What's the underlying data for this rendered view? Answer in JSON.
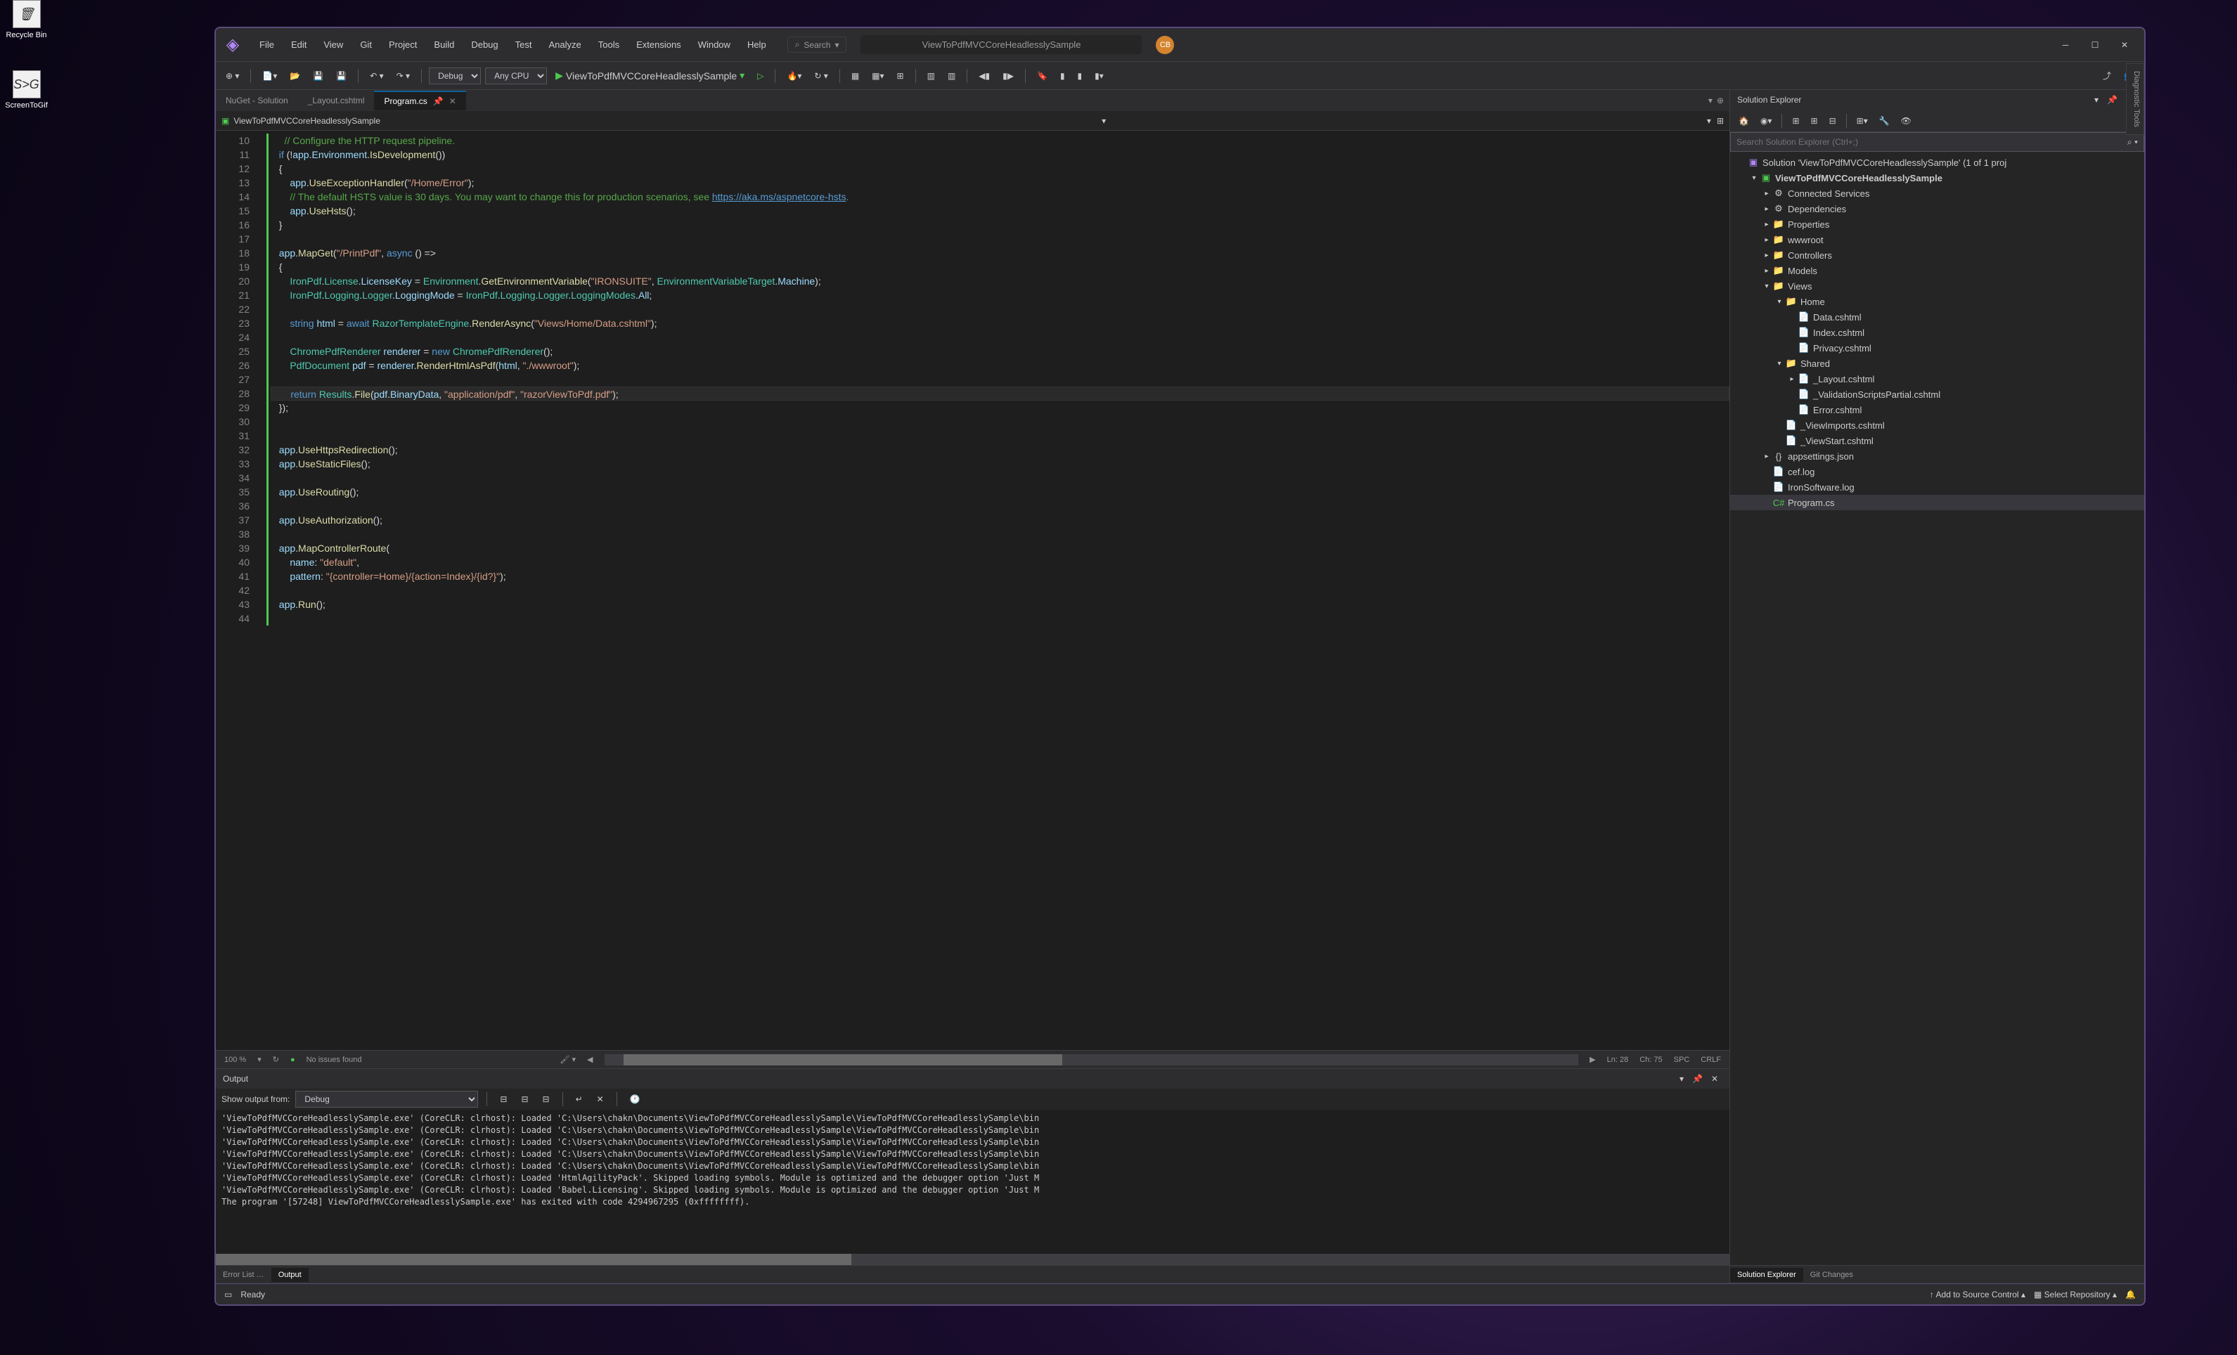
{
  "desktop": {
    "recycle": "Recycle Bin",
    "s2g": "ScreenToGif",
    "s2g_badge": "S>G"
  },
  "menus": [
    "File",
    "Edit",
    "View",
    "Git",
    "Project",
    "Build",
    "Debug",
    "Test",
    "Analyze",
    "Tools",
    "Extensions",
    "Window",
    "Help"
  ],
  "search": "Search",
  "titlebar": {
    "title": "ViewToPdfMVCCoreHeadlesslySample",
    "avatar": "CB"
  },
  "toolbar": {
    "config": "Debug",
    "platform": "Any CPU",
    "start": "ViewToPdfMVCCoreHeadlesslySample"
  },
  "tabs": [
    {
      "label": "NuGet - Solution",
      "active": false
    },
    {
      "label": "_Layout.cshtml",
      "active": false
    },
    {
      "label": "Program.cs",
      "active": true
    }
  ],
  "navbar": "ViewToPdfMVCCoreHeadlesslySample",
  "code": {
    "start": 10,
    "lines": [
      [
        [
          "comment",
          "    // Configure the HTTP request pipeline."
        ]
      ],
      [
        [
          "plain",
          "  "
        ],
        [
          "keyword",
          "if"
        ],
        [
          "plain",
          " (!"
        ],
        [
          "var",
          "app"
        ],
        [
          "plain",
          "."
        ],
        [
          "var",
          "Environment"
        ],
        [
          "plain",
          "."
        ],
        [
          "method",
          "IsDevelopment"
        ],
        [
          "plain",
          "())"
        ]
      ],
      [
        [
          "plain",
          "  {"
        ]
      ],
      [
        [
          "plain",
          "      "
        ],
        [
          "var",
          "app"
        ],
        [
          "plain",
          "."
        ],
        [
          "method",
          "UseExceptionHandler"
        ],
        [
          "plain",
          "("
        ],
        [
          "string",
          "\"/Home/Error\""
        ],
        [
          "plain",
          ");"
        ]
      ],
      [
        [
          "comment",
          "      // The default HSTS value is 30 days. You may want to change this for production scenarios, see "
        ],
        [
          "link",
          "https://aka.ms/aspnetcore-hsts"
        ],
        [
          "comment",
          "."
        ]
      ],
      [
        [
          "plain",
          "      "
        ],
        [
          "var",
          "app"
        ],
        [
          "plain",
          "."
        ],
        [
          "method",
          "UseHsts"
        ],
        [
          "plain",
          "();"
        ]
      ],
      [
        [
          "plain",
          "  }"
        ]
      ],
      [],
      [
        [
          "plain",
          "  "
        ],
        [
          "var",
          "app"
        ],
        [
          "plain",
          "."
        ],
        [
          "method",
          "MapGet"
        ],
        [
          "plain",
          "("
        ],
        [
          "string",
          "\"/PrintPdf\""
        ],
        [
          "plain",
          ", "
        ],
        [
          "keyword",
          "async"
        ],
        [
          "plain",
          " () =>"
        ]
      ],
      [
        [
          "plain",
          "  {"
        ]
      ],
      [
        [
          "plain",
          "      "
        ],
        [
          "type",
          "IronPdf"
        ],
        [
          "plain",
          "."
        ],
        [
          "type",
          "License"
        ],
        [
          "plain",
          "."
        ],
        [
          "var",
          "LicenseKey"
        ],
        [
          "plain",
          " = "
        ],
        [
          "type",
          "Environment"
        ],
        [
          "plain",
          "."
        ],
        [
          "method",
          "GetEnvironmentVariable"
        ],
        [
          "plain",
          "("
        ],
        [
          "string",
          "\"IRONSUITE\""
        ],
        [
          "plain",
          ", "
        ],
        [
          "type",
          "EnvironmentVariableTarget"
        ],
        [
          "plain",
          "."
        ],
        [
          "var",
          "Machine"
        ],
        [
          "plain",
          ");"
        ]
      ],
      [
        [
          "plain",
          "      "
        ],
        [
          "type",
          "IronPdf"
        ],
        [
          "plain",
          "."
        ],
        [
          "type",
          "Logging"
        ],
        [
          "plain",
          "."
        ],
        [
          "type",
          "Logger"
        ],
        [
          "plain",
          "."
        ],
        [
          "var",
          "LoggingMode"
        ],
        [
          "plain",
          " = "
        ],
        [
          "type",
          "IronPdf"
        ],
        [
          "plain",
          "."
        ],
        [
          "type",
          "Logging"
        ],
        [
          "plain",
          "."
        ],
        [
          "type",
          "Logger"
        ],
        [
          "plain",
          "."
        ],
        [
          "type",
          "LoggingModes"
        ],
        [
          "plain",
          "."
        ],
        [
          "var",
          "All"
        ],
        [
          "plain",
          ";"
        ]
      ],
      [],
      [
        [
          "plain",
          "      "
        ],
        [
          "keyword",
          "string"
        ],
        [
          "plain",
          " "
        ],
        [
          "var",
          "html"
        ],
        [
          "plain",
          " = "
        ],
        [
          "keyword",
          "await"
        ],
        [
          "plain",
          " "
        ],
        [
          "type",
          "RazorTemplateEngine"
        ],
        [
          "plain",
          "."
        ],
        [
          "method",
          "RenderAsync"
        ],
        [
          "plain",
          "("
        ],
        [
          "string",
          "\"Views/Home/Data.cshtml\""
        ],
        [
          "plain",
          ");"
        ]
      ],
      [],
      [
        [
          "plain",
          "      "
        ],
        [
          "type",
          "ChromePdfRenderer"
        ],
        [
          "plain",
          " "
        ],
        [
          "var",
          "renderer"
        ],
        [
          "plain",
          " = "
        ],
        [
          "keyword",
          "new"
        ],
        [
          "plain",
          " "
        ],
        [
          "type",
          "ChromePdfRenderer"
        ],
        [
          "plain",
          "();"
        ]
      ],
      [
        [
          "plain",
          "      "
        ],
        [
          "type",
          "PdfDocument"
        ],
        [
          "plain",
          " "
        ],
        [
          "var",
          "pdf"
        ],
        [
          "plain",
          " = "
        ],
        [
          "var",
          "renderer"
        ],
        [
          "plain",
          "."
        ],
        [
          "method",
          "RenderHtmlAsPdf"
        ],
        [
          "plain",
          "("
        ],
        [
          "var",
          "html"
        ],
        [
          "plain",
          ", "
        ],
        [
          "string",
          "\"./wwwroot\""
        ],
        [
          "plain",
          ");"
        ]
      ],
      [],
      [
        [
          "plain",
          "      "
        ],
        [
          "keyword",
          "return"
        ],
        [
          "plain",
          " "
        ],
        [
          "type",
          "Results"
        ],
        [
          "plain",
          "."
        ],
        [
          "method",
          "File"
        ],
        [
          "plain",
          "("
        ],
        [
          "var",
          "pdf"
        ],
        [
          "plain",
          "."
        ],
        [
          "var",
          "BinaryData"
        ],
        [
          "plain",
          ", "
        ],
        [
          "string",
          "\"application/pdf\""
        ],
        [
          "plain",
          ", "
        ],
        [
          "string",
          "\"razorViewToPdf.pdf\""
        ],
        [
          "plain",
          ");"
        ]
      ],
      [
        [
          "plain",
          "  });"
        ]
      ],
      [],
      [],
      [
        [
          "plain",
          "  "
        ],
        [
          "var",
          "app"
        ],
        [
          "plain",
          "."
        ],
        [
          "method",
          "UseHttpsRedirection"
        ],
        [
          "plain",
          "();"
        ]
      ],
      [
        [
          "plain",
          "  "
        ],
        [
          "var",
          "app"
        ],
        [
          "plain",
          "."
        ],
        [
          "method",
          "UseStaticFiles"
        ],
        [
          "plain",
          "();"
        ]
      ],
      [],
      [
        [
          "plain",
          "  "
        ],
        [
          "var",
          "app"
        ],
        [
          "plain",
          "."
        ],
        [
          "method",
          "UseRouting"
        ],
        [
          "plain",
          "();"
        ]
      ],
      [],
      [
        [
          "plain",
          "  "
        ],
        [
          "var",
          "app"
        ],
        [
          "plain",
          "."
        ],
        [
          "method",
          "UseAuthorization"
        ],
        [
          "plain",
          "();"
        ]
      ],
      [],
      [
        [
          "plain",
          "  "
        ],
        [
          "var",
          "app"
        ],
        [
          "plain",
          "."
        ],
        [
          "method",
          "MapControllerRoute"
        ],
        [
          "plain",
          "("
        ]
      ],
      [
        [
          "plain",
          "      "
        ],
        [
          "var",
          "name"
        ],
        [
          "plain",
          ": "
        ],
        [
          "string",
          "\"default\""
        ],
        [
          "plain",
          ","
        ]
      ],
      [
        [
          "plain",
          "      "
        ],
        [
          "var",
          "pattern"
        ],
        [
          "plain",
          ": "
        ],
        [
          "string",
          "\"{controller=Home}/{action=Index}/{id?}\""
        ],
        [
          "plain",
          ");"
        ]
      ],
      [],
      [
        [
          "plain",
          "  "
        ],
        [
          "var",
          "app"
        ],
        [
          "plain",
          "."
        ],
        [
          "method",
          "Run"
        ],
        [
          "plain",
          "();"
        ]
      ],
      []
    ],
    "current_line": 28
  },
  "editor_status": {
    "zoom": "100 %",
    "issues": "No issues found",
    "ln": "Ln: 28",
    "ch": "Ch: 75",
    "spc": "SPC",
    "crlf": "CRLF"
  },
  "output": {
    "title": "Output",
    "show_from": "Show output from:",
    "source": "Debug",
    "lines": [
      "'ViewToPdfMVCCoreHeadlesslySample.exe' (CoreCLR: clrhost): Loaded 'C:\\Users\\chakn\\Documents\\ViewToPdfMVCCoreHeadlesslySample\\ViewToPdfMVCCoreHeadlesslySample\\bin",
      "'ViewToPdfMVCCoreHeadlesslySample.exe' (CoreCLR: clrhost): Loaded 'C:\\Users\\chakn\\Documents\\ViewToPdfMVCCoreHeadlesslySample\\ViewToPdfMVCCoreHeadlesslySample\\bin",
      "'ViewToPdfMVCCoreHeadlesslySample.exe' (CoreCLR: clrhost): Loaded 'C:\\Users\\chakn\\Documents\\ViewToPdfMVCCoreHeadlesslySample\\ViewToPdfMVCCoreHeadlesslySample\\bin",
      "'ViewToPdfMVCCoreHeadlesslySample.exe' (CoreCLR: clrhost): Loaded 'C:\\Users\\chakn\\Documents\\ViewToPdfMVCCoreHeadlesslySample\\ViewToPdfMVCCoreHeadlesslySample\\bin",
      "'ViewToPdfMVCCoreHeadlesslySample.exe' (CoreCLR: clrhost): Loaded 'C:\\Users\\chakn\\Documents\\ViewToPdfMVCCoreHeadlesslySample\\ViewToPdfMVCCoreHeadlesslySample\\bin",
      "'ViewToPdfMVCCoreHeadlesslySample.exe' (CoreCLR: clrhost): Loaded 'HtmlAgilityPack'. Skipped loading symbols. Module is optimized and the debugger option 'Just M",
      "'ViewToPdfMVCCoreHeadlesslySample.exe' (CoreCLR: clrhost): Loaded 'Babel.Licensing'. Skipped loading symbols. Module is optimized and the debugger option 'Just M",
      "The program '[57248] ViewToPdfMVCCoreHeadlesslySample.exe' has exited with code 4294967295 (0xffffffff)."
    ]
  },
  "bottom_tabs": [
    "Error List …",
    "Output"
  ],
  "solution": {
    "title": "Solution Explorer",
    "search_placeholder": "Search Solution Explorer (Ctrl+;)",
    "tree": [
      {
        "d": 0,
        "icon": "sln",
        "label": "Solution 'ViewToPdfMVCCoreHeadlesslySample' (1 of 1 proj",
        "arrow": ""
      },
      {
        "d": 1,
        "icon": "proj",
        "label": "ViewToPdfMVCCoreHeadlesslySample",
        "arrow": "▾",
        "bold": true
      },
      {
        "d": 2,
        "icon": "dep",
        "label": "Connected Services",
        "arrow": "▸"
      },
      {
        "d": 2,
        "icon": "dep",
        "label": "Dependencies",
        "arrow": "▸"
      },
      {
        "d": 2,
        "icon": "folder",
        "label": "Properties",
        "arrow": "▸"
      },
      {
        "d": 2,
        "icon": "folder",
        "label": "wwwroot",
        "arrow": "▸"
      },
      {
        "d": 2,
        "icon": "folder",
        "label": "Controllers",
        "arrow": "▸"
      },
      {
        "d": 2,
        "icon": "folder",
        "label": "Models",
        "arrow": "▸"
      },
      {
        "d": 2,
        "icon": "folder",
        "label": "Views",
        "arrow": "▾"
      },
      {
        "d": 3,
        "icon": "folder",
        "label": "Home",
        "arrow": "▾"
      },
      {
        "d": 4,
        "icon": "file",
        "label": "Data.cshtml",
        "arrow": ""
      },
      {
        "d": 4,
        "icon": "file",
        "label": "Index.cshtml",
        "arrow": ""
      },
      {
        "d": 4,
        "icon": "file",
        "label": "Privacy.cshtml",
        "arrow": ""
      },
      {
        "d": 3,
        "icon": "folder",
        "label": "Shared",
        "arrow": "▾"
      },
      {
        "d": 4,
        "icon": "file",
        "label": "_Layout.cshtml",
        "arrow": "▸"
      },
      {
        "d": 4,
        "icon": "file",
        "label": "_ValidationScriptsPartial.cshtml",
        "arrow": ""
      },
      {
        "d": 4,
        "icon": "file",
        "label": "Error.cshtml",
        "arrow": ""
      },
      {
        "d": 3,
        "icon": "file",
        "label": "_ViewImports.cshtml",
        "arrow": ""
      },
      {
        "d": 3,
        "icon": "file",
        "label": "_ViewStart.cshtml",
        "arrow": ""
      },
      {
        "d": 2,
        "icon": "json",
        "label": "appsettings.json",
        "arrow": "▸"
      },
      {
        "d": 2,
        "icon": "file",
        "label": "cef.log",
        "arrow": ""
      },
      {
        "d": 2,
        "icon": "file",
        "label": "IronSoftware.log",
        "arrow": ""
      },
      {
        "d": 2,
        "icon": "cs",
        "label": "Program.cs",
        "arrow": "",
        "selected": true
      }
    ]
  },
  "sol_bottom_tabs": [
    "Solution Explorer",
    "Git Changes"
  ],
  "statusbar": {
    "ready": "Ready",
    "add_source": "Add to Source Control",
    "select_repo": "Select Repository"
  },
  "diag": "Diagnostic Tools"
}
